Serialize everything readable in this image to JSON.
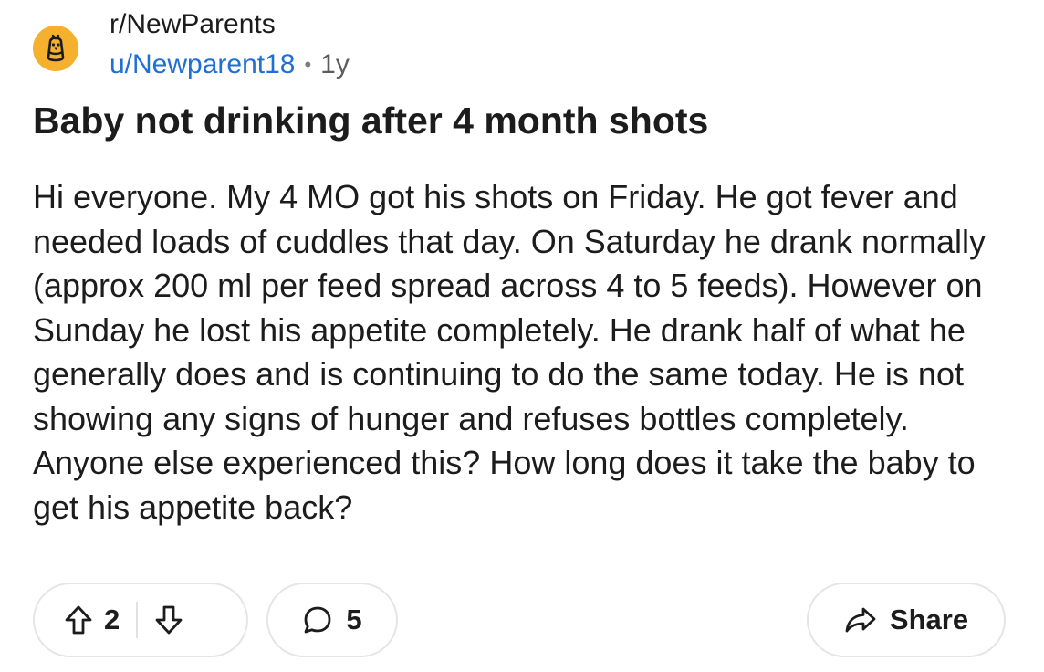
{
  "post": {
    "subreddit": "r/NewParents",
    "username": "u/Newparent18",
    "separator": "•",
    "age": "1y",
    "title": "Baby not drinking after 4 month shots",
    "body": "Hi everyone. My 4 MO got his shots on Friday. He got fever and needed loads of cuddles that day. On Saturday he drank normally (approx 200 ml per feed spread across 4 to 5 feeds). However on Sunday he lost his appetite completely. He drank half of what he generally does and is continuing to do the same today. He is not showing any signs of hunger and refuses bottles completely. Anyone else experienced this? How long does it take the baby to get his appetite back?"
  },
  "actions": {
    "score": "2",
    "comment_count": "5",
    "share_label": "Share"
  },
  "icons": {
    "avatar": "subreddit-chick-icon",
    "upvote": "arrow-up-icon",
    "downvote": "arrow-down-icon",
    "comment": "speech-bubble-icon",
    "share": "share-arrow-icon"
  },
  "colors": {
    "avatar_bg": "#f5b02e",
    "username": "#1f6fd6",
    "text": "#1c1c1c",
    "pill_border": "#e3e5e8"
  }
}
